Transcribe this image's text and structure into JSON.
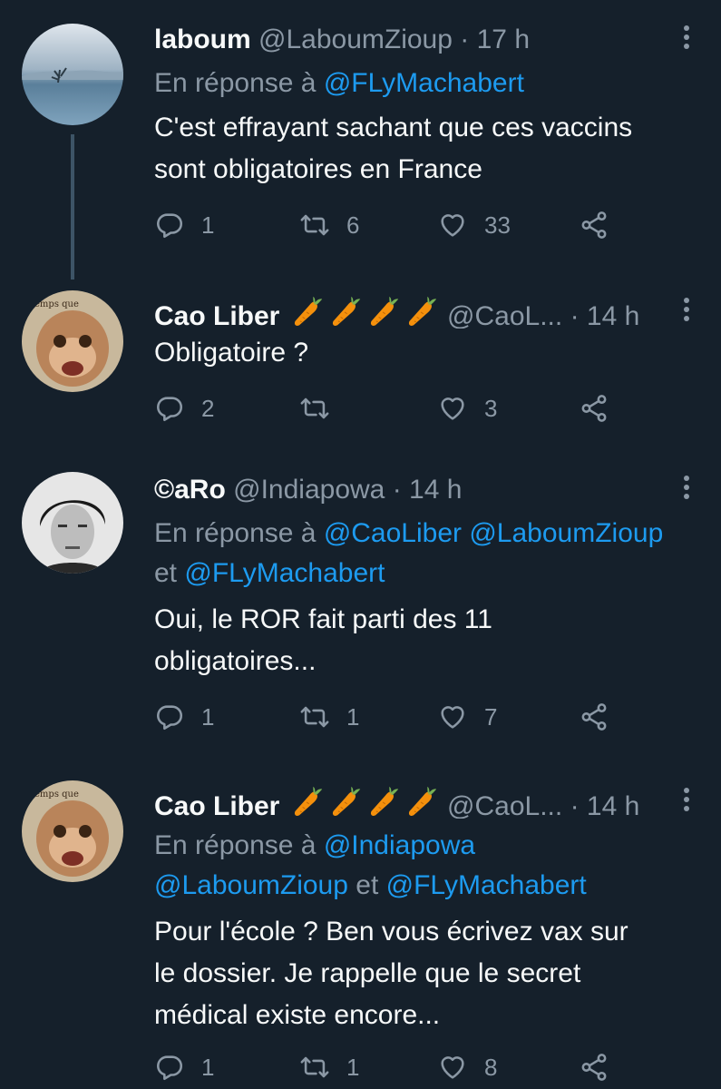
{
  "tweets": [
    {
      "name": "laboum",
      "handle": "@LaboumZioup",
      "sep": "·",
      "time": "17 h",
      "reply_prefix": "En réponse à",
      "reply_mentions": "@FLyMachabert",
      "reply_mentions2": "",
      "text_lines": [
        "C'est effrayant sachant que ces vaccins",
        "sont obligatoires en France"
      ],
      "replies": "1",
      "retweets": "6",
      "likes": "33"
    },
    {
      "name": "Cao Liber",
      "handle": "@CaoL...",
      "sep": "·",
      "time": "14 h",
      "text_lines": [
        "Obligatoire ?"
      ],
      "replies": "2",
      "retweets": "",
      "likes": "3"
    },
    {
      "name": "©aRo",
      "handle": "@Indiapowa",
      "sep": "·",
      "time": "14 h",
      "reply_prefix": "En réponse à",
      "reply_mentions": "@CaoLiber @LaboumZioup",
      "reply_mentions2_prefix": "et",
      "reply_mentions2": "@FLyMachabert",
      "text_lines": [
        "Oui, le ROR fait parti des 11",
        "obligatoires..."
      ],
      "replies": "1",
      "retweets": "1",
      "likes": "7"
    },
    {
      "name": "Cao Liber",
      "handle": "@CaoL...",
      "sep": "·",
      "time": "14 h",
      "reply_prefix": "En réponse à",
      "reply_mentions": "@Indiapowa",
      "reply_mentions2a": "@LaboumZioup",
      "reply_mentions2_mid": "et",
      "reply_mentions2b": "@FLyMachabert",
      "text_lines": [
        "Pour l'école ?  Ben vous écrivez vax sur",
        "le dossier.  Je rappelle que le secret",
        "médical existe encore..."
      ],
      "replies": "1",
      "retweets": "1",
      "likes": "8"
    }
  ],
  "colors": {
    "background": "#15202b",
    "accent": "#1d9bf0",
    "muted": "#8b98a5",
    "text": "#f7f9f9"
  },
  "icons": [
    "reply-icon",
    "retweet-icon",
    "like-icon",
    "share-icon",
    "more-icon",
    "carrot-emoji"
  ]
}
